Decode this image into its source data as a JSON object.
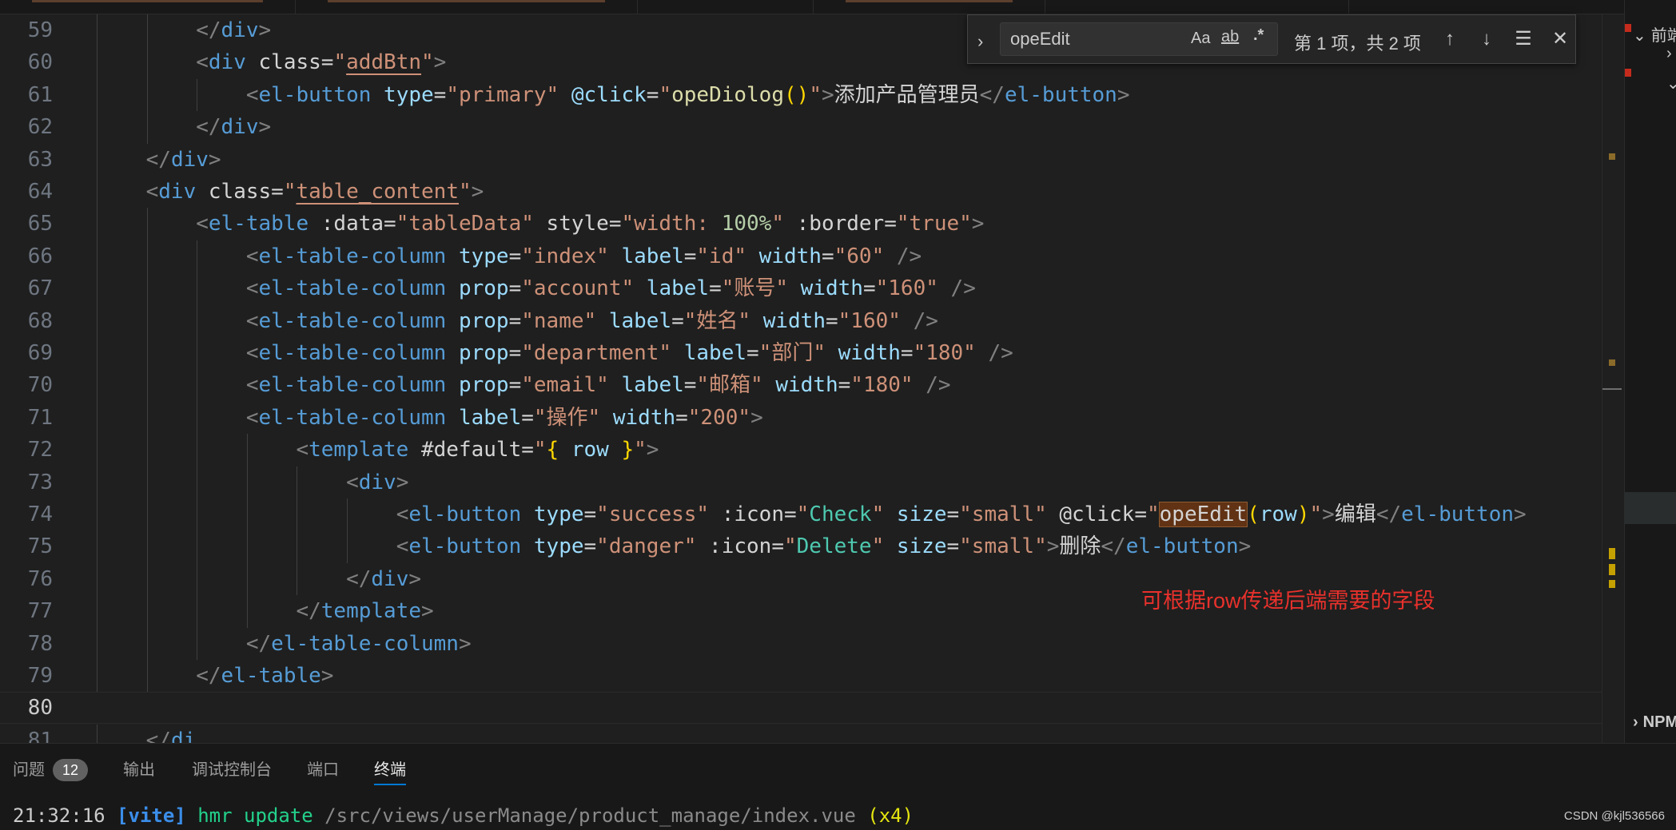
{
  "find": {
    "query": "opeEdit",
    "match_case_label": "Aa",
    "whole_word_label": "ab",
    "regex_label": ".*",
    "result_count": "第 1 项，共 2 项"
  },
  "right_panel": {
    "header": "前端",
    "npm_label": "NPM"
  },
  "annotation": "可根据row传递后端需要的字段",
  "panel": {
    "tabs": [
      "问题",
      "输出",
      "调试控制台",
      "端口",
      "终端"
    ],
    "problems_count": "12",
    "terminal": {
      "time": "21:32:16",
      "tag": "[vite]",
      "action": "hmr update",
      "path": "/src/views/userManage/product_manage/index.vue",
      "count": "(x4)"
    }
  },
  "watermark": "CSDN @kjl536566",
  "colors": {
    "annotation": "#e8312c",
    "accent": "#0078d4",
    "find_highlight": "#613214"
  },
  "editor": {
    "current_line": 80,
    "lines": [
      {
        "n": "59",
        "indent": 2,
        "tokens": [
          [
            "punc",
            "</"
          ],
          [
            "tag",
            "div"
          ],
          [
            "punc",
            ">"
          ]
        ]
      },
      {
        "n": "60",
        "indent": 2,
        "tokens": [
          [
            "punc",
            "<"
          ],
          [
            "tag",
            "div"
          ],
          [
            "attrw",
            " class"
          ],
          [
            "text",
            "="
          ],
          [
            "str",
            "\""
          ],
          [
            "stru",
            "addBtn"
          ],
          [
            "str",
            "\""
          ],
          [
            "punc",
            ">"
          ]
        ]
      },
      {
        "n": "61",
        "indent": 3,
        "tokens": [
          [
            "punc",
            "<"
          ],
          [
            "tag",
            "el-button"
          ],
          [
            "attr",
            " type"
          ],
          [
            "text",
            "="
          ],
          [
            "str",
            "\"primary\""
          ],
          [
            "attr",
            " @click"
          ],
          [
            "text",
            "="
          ],
          [
            "str",
            "\""
          ],
          [
            "fn",
            "opeDiolog"
          ],
          [
            "brace",
            "()"
          ],
          [
            "str",
            "\""
          ],
          [
            "punc",
            ">"
          ],
          [
            "text",
            "添加产品管理员"
          ],
          [
            "punc",
            "</"
          ],
          [
            "tag",
            "el-button"
          ],
          [
            "punc",
            ">"
          ]
        ]
      },
      {
        "n": "62",
        "indent": 2,
        "tokens": [
          [
            "punc",
            "</"
          ],
          [
            "tag",
            "div"
          ],
          [
            "punc",
            ">"
          ]
        ]
      },
      {
        "n": "63",
        "indent": 1,
        "tokens": [
          [
            "punc",
            "</"
          ],
          [
            "tag",
            "div"
          ],
          [
            "punc",
            ">"
          ]
        ]
      },
      {
        "n": "64",
        "indent": 1,
        "tokens": [
          [
            "punc",
            "<"
          ],
          [
            "tag",
            "div"
          ],
          [
            "attrw",
            " class"
          ],
          [
            "text",
            "="
          ],
          [
            "str",
            "\""
          ],
          [
            "stru",
            "table_content"
          ],
          [
            "str",
            "\""
          ],
          [
            "punc",
            ">"
          ]
        ]
      },
      {
        "n": "65",
        "indent": 2,
        "tokens": [
          [
            "punc",
            "<"
          ],
          [
            "tag",
            "el-table"
          ],
          [
            "attrw",
            " :data"
          ],
          [
            "text",
            "="
          ],
          [
            "str",
            "\"tableData\""
          ],
          [
            "attrw",
            " style"
          ],
          [
            "text",
            "="
          ],
          [
            "str",
            "\"width: "
          ],
          [
            "num",
            "100%"
          ],
          [
            "str",
            "\""
          ],
          [
            "attrw",
            " :border"
          ],
          [
            "text",
            "="
          ],
          [
            "str",
            "\"true\""
          ],
          [
            "punc",
            ">"
          ]
        ]
      },
      {
        "n": "66",
        "indent": 3,
        "tokens": [
          [
            "punc",
            "<"
          ],
          [
            "tag",
            "el-table-column"
          ],
          [
            "attr",
            " type"
          ],
          [
            "text",
            "="
          ],
          [
            "str",
            "\"index\""
          ],
          [
            "attr",
            " label"
          ],
          [
            "text",
            "="
          ],
          [
            "str",
            "\"id\""
          ],
          [
            "attr",
            " width"
          ],
          [
            "text",
            "="
          ],
          [
            "str",
            "\"60\""
          ],
          [
            "punc",
            " />"
          ]
        ]
      },
      {
        "n": "67",
        "indent": 3,
        "tokens": [
          [
            "punc",
            "<"
          ],
          [
            "tag",
            "el-table-column"
          ],
          [
            "attr",
            " prop"
          ],
          [
            "text",
            "="
          ],
          [
            "str",
            "\"account\""
          ],
          [
            "attr",
            " label"
          ],
          [
            "text",
            "="
          ],
          [
            "str",
            "\"账号\""
          ],
          [
            "attr",
            " width"
          ],
          [
            "text",
            "="
          ],
          [
            "str",
            "\"160\""
          ],
          [
            "punc",
            " />"
          ]
        ]
      },
      {
        "n": "68",
        "indent": 3,
        "tokens": [
          [
            "punc",
            "<"
          ],
          [
            "tag",
            "el-table-column"
          ],
          [
            "attr",
            " prop"
          ],
          [
            "text",
            "="
          ],
          [
            "str",
            "\"name\""
          ],
          [
            "attr",
            " label"
          ],
          [
            "text",
            "="
          ],
          [
            "str",
            "\"姓名\""
          ],
          [
            "attr",
            " width"
          ],
          [
            "text",
            "="
          ],
          [
            "str",
            "\"160\""
          ],
          [
            "punc",
            " />"
          ]
        ]
      },
      {
        "n": "69",
        "indent": 3,
        "tokens": [
          [
            "punc",
            "<"
          ],
          [
            "tag",
            "el-table-column"
          ],
          [
            "attr",
            " prop"
          ],
          [
            "text",
            "="
          ],
          [
            "str",
            "\"department\""
          ],
          [
            "attr",
            " label"
          ],
          [
            "text",
            "="
          ],
          [
            "str",
            "\"部门\""
          ],
          [
            "attr",
            " width"
          ],
          [
            "text",
            "="
          ],
          [
            "str",
            "\"180\""
          ],
          [
            "punc",
            " />"
          ]
        ]
      },
      {
        "n": "70",
        "indent": 3,
        "tokens": [
          [
            "punc",
            "<"
          ],
          [
            "tag",
            "el-table-column"
          ],
          [
            "attr",
            " prop"
          ],
          [
            "text",
            "="
          ],
          [
            "str",
            "\"email\""
          ],
          [
            "attr",
            " label"
          ],
          [
            "text",
            "="
          ],
          [
            "str",
            "\"邮箱\""
          ],
          [
            "attr",
            " width"
          ],
          [
            "text",
            "="
          ],
          [
            "str",
            "\"180\""
          ],
          [
            "punc",
            " />"
          ]
        ]
      },
      {
        "n": "71",
        "indent": 3,
        "tokens": [
          [
            "punc",
            "<"
          ],
          [
            "tag",
            "el-table-column"
          ],
          [
            "attr",
            " label"
          ],
          [
            "text",
            "="
          ],
          [
            "str",
            "\"操作\""
          ],
          [
            "attr",
            " width"
          ],
          [
            "text",
            "="
          ],
          [
            "str",
            "\"200\""
          ],
          [
            "punc",
            ">"
          ]
        ]
      },
      {
        "n": "72",
        "indent": 4,
        "tokens": [
          [
            "punc",
            "<"
          ],
          [
            "tag",
            "template"
          ],
          [
            "attrw",
            " #default"
          ],
          [
            "text",
            "="
          ],
          [
            "str",
            "\""
          ],
          [
            "brace",
            "{"
          ],
          [
            "var",
            " row "
          ],
          [
            "brace",
            "}"
          ],
          [
            "str",
            "\""
          ],
          [
            "punc",
            ">"
          ]
        ]
      },
      {
        "n": "73",
        "indent": 5,
        "tokens": [
          [
            "punc",
            "<"
          ],
          [
            "tag",
            "div"
          ],
          [
            "punc",
            ">"
          ]
        ]
      },
      {
        "n": "74",
        "indent": 6,
        "tokens": [
          [
            "punc",
            "<"
          ],
          [
            "tag",
            "el-button"
          ],
          [
            "attr",
            " type"
          ],
          [
            "text",
            "="
          ],
          [
            "str",
            "\"success\""
          ],
          [
            "attrw",
            " :icon"
          ],
          [
            "text",
            "="
          ],
          [
            "str",
            "\""
          ],
          [
            "green",
            "Check"
          ],
          [
            "str",
            "\""
          ],
          [
            "attr",
            " size"
          ],
          [
            "text",
            "="
          ],
          [
            "str",
            "\"small\""
          ],
          [
            "attrw",
            " @click"
          ],
          [
            "text",
            "="
          ],
          [
            "str",
            "\""
          ],
          [
            "hl",
            "opeEdit"
          ],
          [
            "brace",
            "("
          ],
          [
            "var",
            "row"
          ],
          [
            "brace",
            ")"
          ],
          [
            "str",
            "\""
          ],
          [
            "punc",
            ">"
          ],
          [
            "text",
            "编辑"
          ],
          [
            "punc",
            "</"
          ],
          [
            "tag",
            "el-button"
          ],
          [
            "punc",
            ">"
          ]
        ]
      },
      {
        "n": "75",
        "indent": 6,
        "tokens": [
          [
            "punc",
            "<"
          ],
          [
            "tag",
            "el-button"
          ],
          [
            "attr",
            " type"
          ],
          [
            "text",
            "="
          ],
          [
            "str",
            "\"danger\""
          ],
          [
            "attrw",
            " :icon"
          ],
          [
            "text",
            "="
          ],
          [
            "str",
            "\""
          ],
          [
            "green",
            "Delete"
          ],
          [
            "str",
            "\""
          ],
          [
            "attr",
            " size"
          ],
          [
            "text",
            "="
          ],
          [
            "str",
            "\"small\""
          ],
          [
            "punc",
            ">"
          ],
          [
            "text",
            "删除"
          ],
          [
            "punc",
            "</"
          ],
          [
            "tag",
            "el-button"
          ],
          [
            "punc",
            ">"
          ]
        ]
      },
      {
        "n": "76",
        "indent": 5,
        "tokens": [
          [
            "punc",
            "</"
          ],
          [
            "tag",
            "div"
          ],
          [
            "punc",
            ">"
          ]
        ]
      },
      {
        "n": "77",
        "indent": 4,
        "tokens": [
          [
            "punc",
            "</"
          ],
          [
            "tag",
            "template"
          ],
          [
            "punc",
            ">"
          ]
        ]
      },
      {
        "n": "78",
        "indent": 3,
        "tokens": [
          [
            "punc",
            "</"
          ],
          [
            "tag",
            "el-table-column"
          ],
          [
            "punc",
            ">"
          ]
        ]
      },
      {
        "n": "79",
        "indent": 2,
        "tokens": [
          [
            "punc",
            "</"
          ],
          [
            "tag",
            "el-table"
          ],
          [
            "punc",
            ">"
          ]
        ]
      },
      {
        "n": "80",
        "indent": 0,
        "tokens": []
      },
      {
        "n": "81",
        "indent": 1,
        "tokens": [
          [
            "punc",
            "</"
          ],
          [
            "tag",
            "di"
          ]
        ]
      }
    ]
  }
}
